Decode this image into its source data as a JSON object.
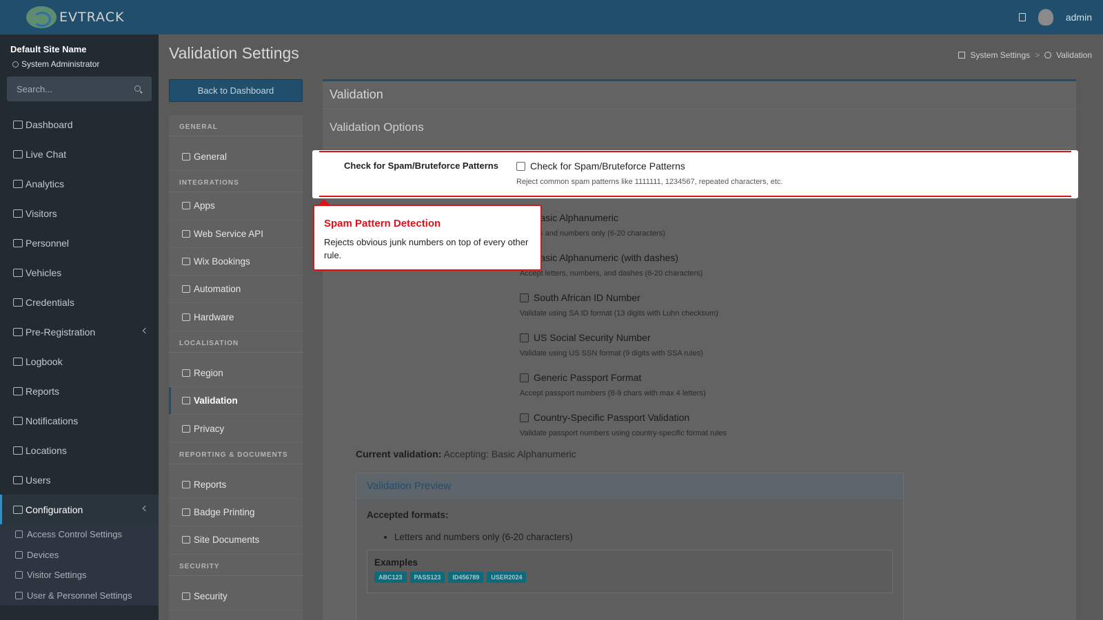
{
  "header": {
    "brand": "EVTRACK",
    "user_name": "admin"
  },
  "sidebar": {
    "site_name": "Default Site Name",
    "user_role": "System Administrator",
    "search_placeholder": "Search...",
    "items": [
      {
        "label": "Dashboard",
        "icon": "dashboard-icon"
      },
      {
        "label": "Live Chat",
        "icon": "headset-icon"
      },
      {
        "label": "Analytics",
        "icon": "target-icon"
      },
      {
        "label": "Visitors",
        "icon": "eye-icon"
      },
      {
        "label": "Personnel",
        "icon": "person-icon"
      },
      {
        "label": "Vehicles",
        "icon": "car-icon"
      },
      {
        "label": "Credentials",
        "icon": "id-card-icon"
      },
      {
        "label": "Pre-Registration",
        "icon": "arrows-icon"
      },
      {
        "label": "Logbook",
        "icon": "book-icon"
      },
      {
        "label": "Reports",
        "icon": "chart-icon"
      },
      {
        "label": "Notifications",
        "icon": "chat-icon"
      },
      {
        "label": "Locations",
        "icon": "map-icon"
      },
      {
        "label": "Users",
        "icon": "users-icon"
      },
      {
        "label": "Configuration",
        "icon": "gear-icon"
      }
    ],
    "sub_items": [
      {
        "label": "Access Control Settings"
      },
      {
        "label": "Devices"
      },
      {
        "label": "Visitor Settings"
      },
      {
        "label": "User & Personnel Settings"
      }
    ]
  },
  "page": {
    "title": "Validation Settings",
    "breadcrumb": [
      "System Settings",
      ">",
      "Validation"
    ],
    "back_button": "Back to Dashboard"
  },
  "settings_nav": {
    "general_header": "GENERAL",
    "general": "General",
    "integrations_header": "INTEGRATIONS",
    "apps": "Apps",
    "web_service_api": "Web Service API",
    "wix_bookings": "Wix Bookings",
    "automation": "Automation",
    "hardware": "Hardware",
    "localisation_header": "LOCALISATION",
    "region": "Region",
    "validation": "Validation",
    "privacy": "Privacy",
    "reporting_header": "REPORTING & DOCUMENTS",
    "reports": "Reports",
    "badge_printing": "Badge Printing",
    "site_documents": "Site Documents",
    "security_header": "SECURITY",
    "security": "Security"
  },
  "panel": {
    "title": "Validation",
    "section_title": "Validation Options",
    "spam_label": "Check for Spam/Bruteforce Patterns",
    "spam_option": "Check for Spam/Bruteforce Patterns",
    "spam_help": "Reject common spam patterns like 1111111, 1234567, repeated characters, etc.",
    "options": [
      {
        "label": "Basic Alphanumeric",
        "help": "Letters and numbers only (6-20 characters)"
      },
      {
        "label": "Basic Alphanumeric (with dashes)",
        "help": "Accept letters, numbers, and dashes (6-20 characters)"
      },
      {
        "label": "South African ID Number",
        "help": "Validate using SA ID format (13 digits with Luhn checksum)"
      },
      {
        "label": "US Social Security Number",
        "help": "Validate using US SSN format (9 digits with SSA rules)"
      },
      {
        "label": "Generic Passport Format",
        "help": "Accept passport numbers (8-9 chars with max 4 letters)"
      },
      {
        "label": "Country-Specific Passport Validation",
        "help": "Validate passport numbers using country-specific format rules"
      }
    ],
    "current_label": "Current validation:",
    "current_value": "Accepting: Basic Alphanumeric",
    "preview_title": "Validation Preview",
    "accepted_label": "Accepted formats:",
    "accepted_formats": [
      "Letters and numbers only (6-20 characters)"
    ],
    "examples_label": "Examples",
    "examples": [
      "ABC123",
      "PASS123",
      "ID456789",
      "USER2024"
    ]
  },
  "callout": {
    "title": "Spam Pattern Detection",
    "text": "Rejects obvious junk numbers on top of every other rule."
  },
  "colors": {
    "accent": "#1f4f6c",
    "highlight": "#e0101a",
    "badge": "#0d6a7b"
  }
}
